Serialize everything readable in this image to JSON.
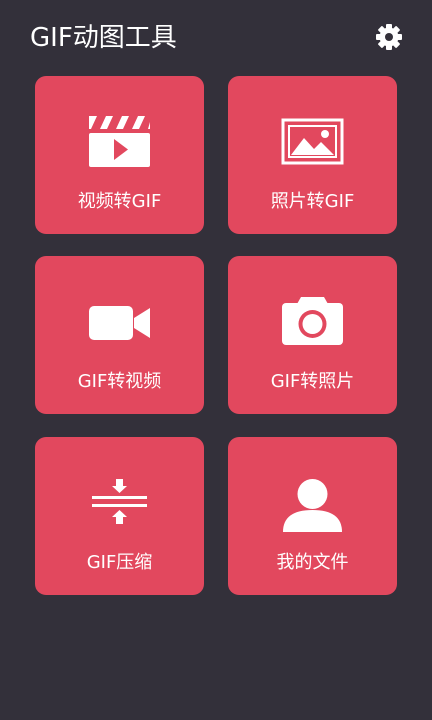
{
  "header": {
    "title": "GIF动图工具",
    "settings_icon": "gear-icon"
  },
  "tiles": [
    {
      "label": "视频转GIF",
      "icon": "video-clapperboard-icon"
    },
    {
      "label": "照片转GIF",
      "icon": "image-landscape-icon"
    },
    {
      "label": "GIF转视频",
      "icon": "video-camera-icon"
    },
    {
      "label": "GIF转照片",
      "icon": "photo-camera-icon"
    },
    {
      "label": "GIF压缩",
      "icon": "compress-arrows-icon"
    },
    {
      "label": "我的文件",
      "icon": "user-profile-icon"
    }
  ],
  "colors": {
    "background": "#33303a",
    "tile": "#e2485e",
    "icon_and_text": "#ffffff"
  }
}
